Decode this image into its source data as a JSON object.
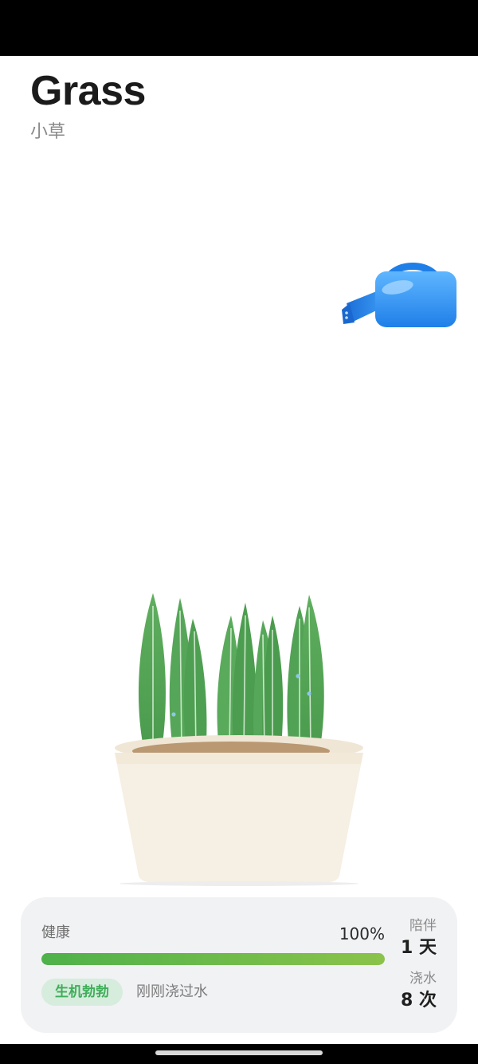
{
  "plant": {
    "name": "Grass",
    "name_cn": "小草"
  },
  "status_card": {
    "health_label": "健康",
    "health_value": "100%",
    "health_fraction": 1.0,
    "status_tag": "生机勃勃",
    "status_text": "刚刚浇过水",
    "companion": {
      "label": "陪伴",
      "value": "1 天"
    },
    "watering": {
      "label": "浇水",
      "value": "8 次"
    }
  },
  "colors": {
    "accent_green": "#4eb14a",
    "tag_text": "#3fae5a",
    "tag_bg": "#d6ecdc",
    "watering_can_blue": "#2f8ff0"
  },
  "icons": {
    "watering_can": "watering-can-icon"
  }
}
